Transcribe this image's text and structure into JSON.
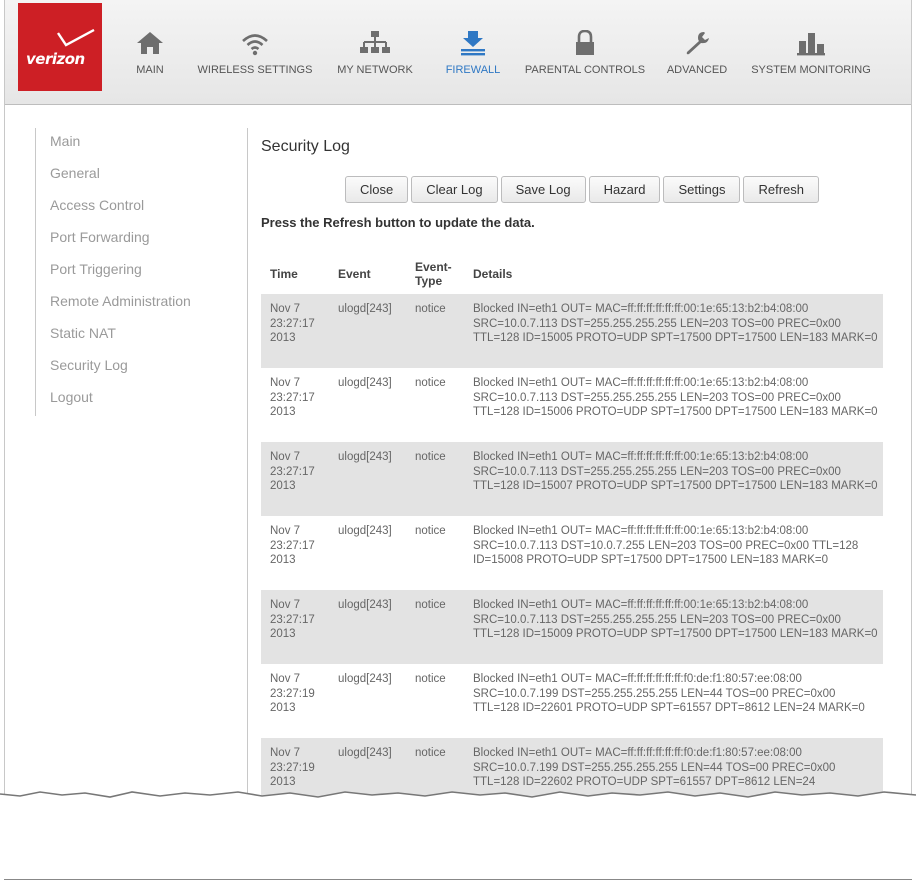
{
  "brand": {
    "logo_text": "verizon",
    "accent": "#cd1f25",
    "active_color": "#2f78c4"
  },
  "nav": [
    {
      "label": "MAIN",
      "icon": "home-icon"
    },
    {
      "label": "WIRELESS SETTINGS",
      "icon": "wifi-icon"
    },
    {
      "label": "MY NETWORK",
      "icon": "network-icon"
    },
    {
      "label": "FIREWALL",
      "icon": "firewall-icon",
      "active": true
    },
    {
      "label": "PARENTAL CONTROLS",
      "icon": "lock-icon"
    },
    {
      "label": "ADVANCED",
      "icon": "wrench-icon"
    },
    {
      "label": "SYSTEM MONITORING",
      "icon": "bar-chart-icon"
    }
  ],
  "sidebar": {
    "items": [
      {
        "label": "Main"
      },
      {
        "label": "General"
      },
      {
        "label": "Access Control"
      },
      {
        "label": "Port Forwarding"
      },
      {
        "label": "Port Triggering"
      },
      {
        "label": "Remote Administration"
      },
      {
        "label": "Static NAT"
      },
      {
        "label": "Security Log"
      },
      {
        "label": "Logout"
      }
    ]
  },
  "main": {
    "title": "Security Log",
    "buttons": [
      "Close",
      "Clear Log",
      "Save Log",
      "Hazard",
      "Settings",
      "Refresh"
    ],
    "hint": "Press the Refresh button to update the data.",
    "columns": [
      "Time",
      "Event",
      "Event-Type",
      "Details"
    ],
    "rows": [
      {
        "date": "Nov 7",
        "time": "23:27:17",
        "year": "2013",
        "event": "ulogd[243]",
        "type": "notice",
        "details": "Blocked IN=eth1 OUT= MAC=ff:ff:ff:ff:ff:ff:00:1e:65:13:b2:b4:08:00 SRC=10.0.7.113 DST=255.255.255.255 LEN=203 TOS=00 PREC=0x00 TTL=128 ID=15005 PROTO=UDP SPT=17500 DPT=17500 LEN=183 MARK=0"
      },
      {
        "date": "Nov 7",
        "time": "23:27:17",
        "year": "2013",
        "event": "ulogd[243]",
        "type": "notice",
        "details": "Blocked IN=eth1 OUT= MAC=ff:ff:ff:ff:ff:ff:00:1e:65:13:b2:b4:08:00 SRC=10.0.7.113 DST=255.255.255.255 LEN=203 TOS=00 PREC=0x00 TTL=128 ID=15006 PROTO=UDP SPT=17500 DPT=17500 LEN=183 MARK=0"
      },
      {
        "date": "Nov 7",
        "time": "23:27:17",
        "year": "2013",
        "event": "ulogd[243]",
        "type": "notice",
        "details": "Blocked IN=eth1 OUT= MAC=ff:ff:ff:ff:ff:ff:00:1e:65:13:b2:b4:08:00 SRC=10.0.7.113 DST=255.255.255.255 LEN=203 TOS=00 PREC=0x00 TTL=128 ID=15007 PROTO=UDP SPT=17500 DPT=17500 LEN=183 MARK=0"
      },
      {
        "date": "Nov 7",
        "time": "23:27:17",
        "year": "2013",
        "event": "ulogd[243]",
        "type": "notice",
        "details": "Blocked IN=eth1 OUT= MAC=ff:ff:ff:ff:ff:ff:00:1e:65:13:b2:b4:08:00 SRC=10.0.7.113 DST=10.0.7.255 LEN=203 TOS=00 PREC=0x00 TTL=128 ID=15008 PROTO=UDP SPT=17500 DPT=17500 LEN=183 MARK=0"
      },
      {
        "date": "Nov 7",
        "time": "23:27:17",
        "year": "2013",
        "event": "ulogd[243]",
        "type": "notice",
        "details": "Blocked IN=eth1 OUT= MAC=ff:ff:ff:ff:ff:ff:00:1e:65:13:b2:b4:08:00 SRC=10.0.7.113 DST=255.255.255.255 LEN=203 TOS=00 PREC=0x00 TTL=128 ID=15009 PROTO=UDP SPT=17500 DPT=17500 LEN=183 MARK=0"
      },
      {
        "date": "Nov 7",
        "time": "23:27:19",
        "year": "2013",
        "event": "ulogd[243]",
        "type": "notice",
        "details": "Blocked IN=eth1 OUT= MAC=ff:ff:ff:ff:ff:ff:f0:de:f1:80:57:ee:08:00 SRC=10.0.7.199 DST=255.255.255.255 LEN=44 TOS=00 PREC=0x00 TTL=128 ID=22601 PROTO=UDP SPT=61557 DPT=8612 LEN=24 MARK=0"
      },
      {
        "date": "Nov 7",
        "time": "23:27:19",
        "year": "2013",
        "event": "ulogd[243]",
        "type": "notice",
        "details": "Blocked IN=eth1 OUT= MAC=ff:ff:ff:ff:ff:ff:f0:de:f1:80:57:ee:08:00 SRC=10.0.7.199 DST=255.255.255.255 LEN=44 TOS=00 PREC=0x00 TTL=128 ID=22602 PROTO=UDP SPT=61557 DPT=8612 LEN=24"
      }
    ]
  }
}
